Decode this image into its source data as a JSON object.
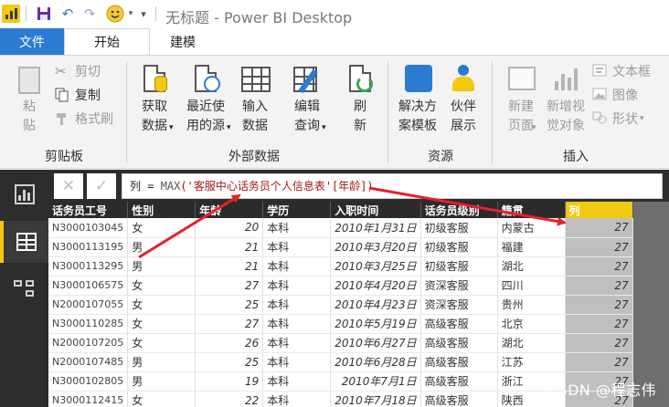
{
  "window": {
    "title": "无标题 - Power BI Desktop"
  },
  "tabs": [
    {
      "label": "文件"
    },
    {
      "label": "开始"
    },
    {
      "label": "建模"
    }
  ],
  "ribbon": {
    "clipboard": {
      "paste": "粘\n贴",
      "cut": "剪切",
      "copy": "复制",
      "format_painter": "格式刷",
      "group_label": "剪贴板"
    },
    "external_data": {
      "get_data": "获取\n数据",
      "recent_sources": "最近使\n用的源",
      "enter_data": "输入\n数据",
      "edit_queries": "编辑\n查询",
      "refresh": "刷\n新",
      "group_label": "外部数据"
    },
    "resources": {
      "solution_templates": "解决方\n案模板",
      "partner_showcase": "伙伴\n展示",
      "group_label": "资源"
    },
    "insert": {
      "new_page": "新建\n页面",
      "new_visual": "新增视\n觉对象",
      "textbox": "文本框",
      "image": "图像",
      "shapes": "形状",
      "group_label": "插入"
    }
  },
  "formula_bar": {
    "cancel_icon": "✕",
    "commit_icon": "✓",
    "prefix": "列 = ",
    "fn": "MAX",
    "arg": "('客服中心话务员个人信息表'[年龄])"
  },
  "table": {
    "columns": [
      "话务员工号",
      "性别",
      "年龄",
      "学历",
      "入职时间",
      "话务员级别",
      "籍贯",
      "列"
    ],
    "rows": [
      [
        "N3000103045",
        "女",
        "20",
        "本科",
        "2010年1月31日",
        "初级客服",
        "内蒙古",
        "27"
      ],
      [
        "N3000113195",
        "男",
        "21",
        "本科",
        "2010年3月20日",
        "初级客服",
        "福建",
        "27"
      ],
      [
        "N3000113295",
        "男",
        "21",
        "本科",
        "2010年3月25日",
        "初级客服",
        "湖北",
        "27"
      ],
      [
        "N3000106575",
        "女",
        "27",
        "本科",
        "2010年4月20日",
        "资深客服",
        "四川",
        "27"
      ],
      [
        "N2000107055",
        "女",
        "25",
        "本科",
        "2010年4月23日",
        "资深客服",
        "贵州",
        "27"
      ],
      [
        "N3000110285",
        "女",
        "27",
        "本科",
        "2010年5月19日",
        "高级客服",
        "北京",
        "27"
      ],
      [
        "N2000107205",
        "女",
        "26",
        "本科",
        "2010年6月27日",
        "高级客服",
        "湖北",
        "27"
      ],
      [
        "N2000107485",
        "男",
        "25",
        "本科",
        "2010年6月28日",
        "高级客服",
        "江苏",
        "27"
      ],
      [
        "N3000102805",
        "男",
        "19",
        "本科",
        "2010年7月1日",
        "高级客服",
        "浙江",
        "27"
      ],
      [
        "N3000112415",
        "女",
        "22",
        "本科",
        "2010年7月18日",
        "高级客服",
        "陕西",
        "27"
      ]
    ]
  },
  "watermark": "CSDN @程志伟",
  "colors": {
    "accent": "#f2c811",
    "file_tab": "#2b7bd3",
    "arrow": "#e8202a",
    "nav_bg": "#2d2d2d"
  }
}
